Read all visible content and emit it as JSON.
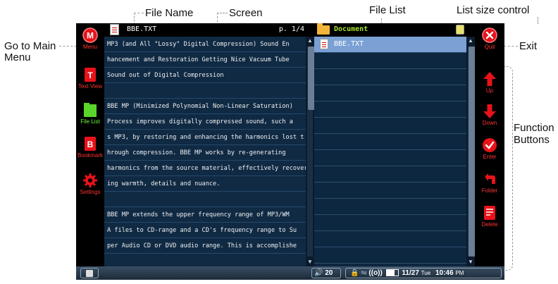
{
  "annotations": {
    "file_name": "File Name",
    "screen": "Screen",
    "file_list": "File List",
    "list_size_control": "List size control",
    "go_to_main_menu_1": "Go to Main",
    "go_to_main_menu_2": "Menu",
    "exit": "Exit",
    "function_buttons_1": "Function",
    "function_buttons_2": "Buttons"
  },
  "sidebar": {
    "items": [
      {
        "label": "Menu",
        "glyph": "M",
        "icon": "menu-icon"
      },
      {
        "label": "Text View",
        "glyph": "T",
        "icon": "text-view-icon"
      },
      {
        "label": "File List",
        "glyph": "",
        "icon": "file-list-icon"
      },
      {
        "label": "Bookmark",
        "glyph": "B",
        "icon": "bookmark-icon"
      },
      {
        "label": "Settings",
        "glyph": "",
        "icon": "settings-gear-icon"
      }
    ]
  },
  "text_view": {
    "file_name": "BBE.TXT",
    "page": "p. 1/4",
    "lines": [
      "MP3 (and All \"Lossy\" Digital Compression) Sound En",
      "hancement and Restoration Getting Nice Vacuum Tube",
      "Sound out of Digital Compression",
      "",
      "BBE MP (Minimized Polynomial Non-Linear Saturation)",
      " Process improves digitally compressed sound, such a",
      "s MP3, by restoring and enhancing the harmonics lost t",
      "hrough compression. BBE MP works by re-generating",
      "harmonics from the source material, effectively recover",
      "ing warmth, details and nuance.",
      "",
      "BBE MP extends the upper frequency range of MP3/WM",
      "A files to CD-range and a CD's frequency range to Su",
      "per Audio CD or DVD audio range. This is accomplishe"
    ]
  },
  "file_list": {
    "folder": "Document",
    "items": [
      "BBE.TXT",
      "",
      "",
      "",
      "",
      "",
      "",
      "",
      "",
      "",
      "",
      "",
      "",
      ""
    ]
  },
  "rightbar": {
    "items": [
      {
        "label": "Quit",
        "icon": "quit-icon"
      },
      {
        "label": "Up",
        "icon": "arrow-up-icon"
      },
      {
        "label": "Down",
        "icon": "arrow-down-icon"
      },
      {
        "label": "Enter",
        "icon": "enter-check-icon"
      },
      {
        "label": "Folder",
        "icon": "folder-back-icon"
      },
      {
        "label": "Delete",
        "icon": "delete-icon"
      }
    ]
  },
  "statusbar": {
    "volume": "20",
    "date": "11/27",
    "weekday": "Tue",
    "time": "10:46",
    "ampm": "PM",
    "wifi": "((o))"
  }
}
